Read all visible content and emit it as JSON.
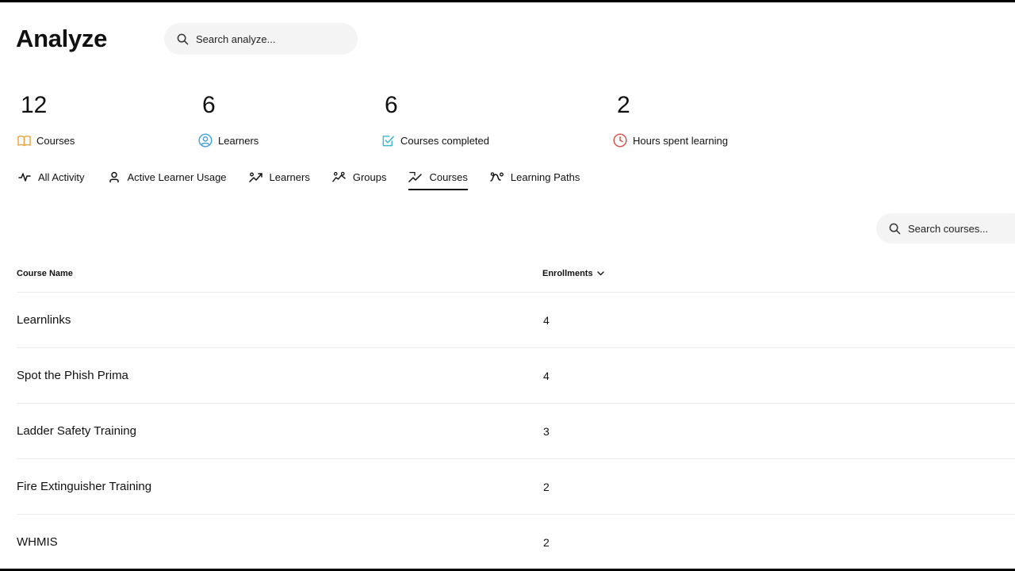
{
  "page": {
    "title": "Analyze"
  },
  "search": {
    "placeholder": "Search analyze..."
  },
  "stats": [
    {
      "value": "12",
      "label": "Courses",
      "icon": "book-icon",
      "color": "#e8a33a"
    },
    {
      "value": "6",
      "label": "Learners",
      "icon": "user-circle-icon",
      "color": "#4aa3d8"
    },
    {
      "value": "6",
      "label": "Courses completed",
      "icon": "checkbox-icon",
      "color": "#3cb8c9"
    },
    {
      "value": "2",
      "label": "Hours spent learning",
      "icon": "clock-icon",
      "color": "#d9534f"
    }
  ],
  "tabs": [
    {
      "label": "All Activity",
      "icon": "activity-icon"
    },
    {
      "label": "Active Learner Usage",
      "icon": "person-icon"
    },
    {
      "label": "Learners",
      "icon": "trend-up-icon"
    },
    {
      "label": "Groups",
      "icon": "group-icon"
    },
    {
      "label": "Courses",
      "icon": "courses-trend-icon",
      "active": true
    },
    {
      "label": "Learning Paths",
      "icon": "path-icon"
    }
  ],
  "courses_search": {
    "placeholder": "Search courses..."
  },
  "table": {
    "headers": {
      "name": "Course Name",
      "enrollments": "Enrollments"
    },
    "sort": {
      "column": "Enrollments",
      "direction": "descending"
    },
    "rows": [
      {
        "name": "Learnlinks",
        "enrollments": "4"
      },
      {
        "name": "Spot the Phish Prima",
        "enrollments": "4"
      },
      {
        "name": "Ladder Safety Training",
        "enrollments": "3"
      },
      {
        "name": "Fire Extinguisher Training",
        "enrollments": "2"
      },
      {
        "name": "WHMIS",
        "enrollments": "2"
      }
    ]
  }
}
